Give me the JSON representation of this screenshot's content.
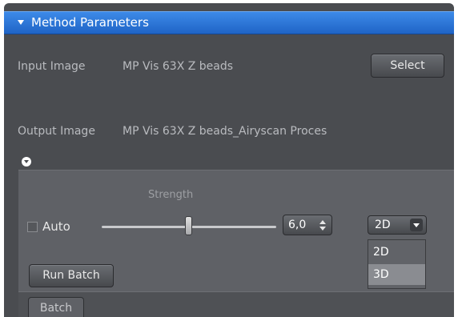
{
  "header": {
    "title": "Method Parameters"
  },
  "input": {
    "label": "Input Image",
    "value": "MP Vis 63X Z beads",
    "select_label": "Select"
  },
  "output": {
    "label": "Output Image",
    "value": "MP Vis 63X Z beads_Airyscan Proces"
  },
  "strength": {
    "label": "Strength",
    "auto_label": "Auto",
    "auto_checked": false,
    "value": "6,0",
    "mode_selected": "2D",
    "mode_options": [
      "2D",
      "3D"
    ],
    "highlighted_option": "3D"
  },
  "run_batch_label": "Run Batch",
  "tabs": [
    {
      "label": "Batch"
    }
  ],
  "colors": {
    "header_blue": "#2a73d8",
    "panel": "#4a4c50",
    "subpanel": "#5f6166"
  }
}
